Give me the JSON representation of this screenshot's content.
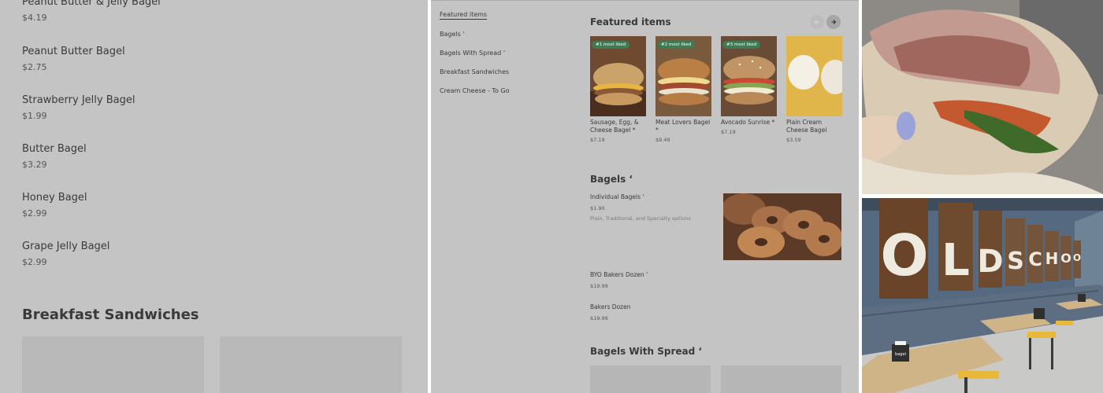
{
  "left_menu": {
    "items": [
      {
        "name": "Peanut Butter & Jelly Bagel",
        "price": "$4.19"
      },
      {
        "name": "Peanut Butter Bagel",
        "price": "$2.75"
      },
      {
        "name": "Strawberry Jelly Bagel",
        "price": "$1.99"
      },
      {
        "name": "Butter Bagel",
        "price": "$3.29"
      },
      {
        "name": "Honey Bagel",
        "price": "$2.99"
      },
      {
        "name": "Grape Jelly Bagel",
        "price": "$2.99"
      }
    ],
    "section_title": "Breakfast Sandwiches"
  },
  "middle_menu": {
    "nav": [
      "Featured items",
      "Bagels ‘",
      "Bagels With Spread ‘",
      "Breakfast Sandwiches",
      "Cream Cheese - To Go"
    ],
    "featured_title": "Featured items",
    "featured": [
      {
        "badge": "#1 most liked",
        "name": "Sausage, Egg, & Cheese Bagel *",
        "price": "$7.19"
      },
      {
        "badge": "#2 most liked",
        "name": "Meat Lovers Bagel *",
        "price": "$9.49"
      },
      {
        "badge": "#3 most liked",
        "name": "Avocado Sunrise *",
        "price": "$7.19"
      },
      {
        "badge": "",
        "name": "Plain Cream Cheese Bagel",
        "price": "$3.59"
      }
    ],
    "bagels_title": "Bagels ‘",
    "bagel_items": [
      {
        "name": "Individual Bagels ‘",
        "price": "$1.90",
        "desc": "Plain, Traditional, and Specialty options"
      },
      {
        "name": "BYO Bakers Dozen ‘",
        "price": "$19.99"
      },
      {
        "name": "Bakers Dozen",
        "price": "$19.99"
      }
    ],
    "spread_title": "Bagels With Spread ‘"
  },
  "photos": {
    "restaurant_sign": "OLDSCHOOL",
    "napkin_label": "bagel"
  },
  "colors": {
    "overlay_gray": "#c4c4c4",
    "badge_green": "#3f7a54",
    "wall_blue": "#5a6f85"
  }
}
